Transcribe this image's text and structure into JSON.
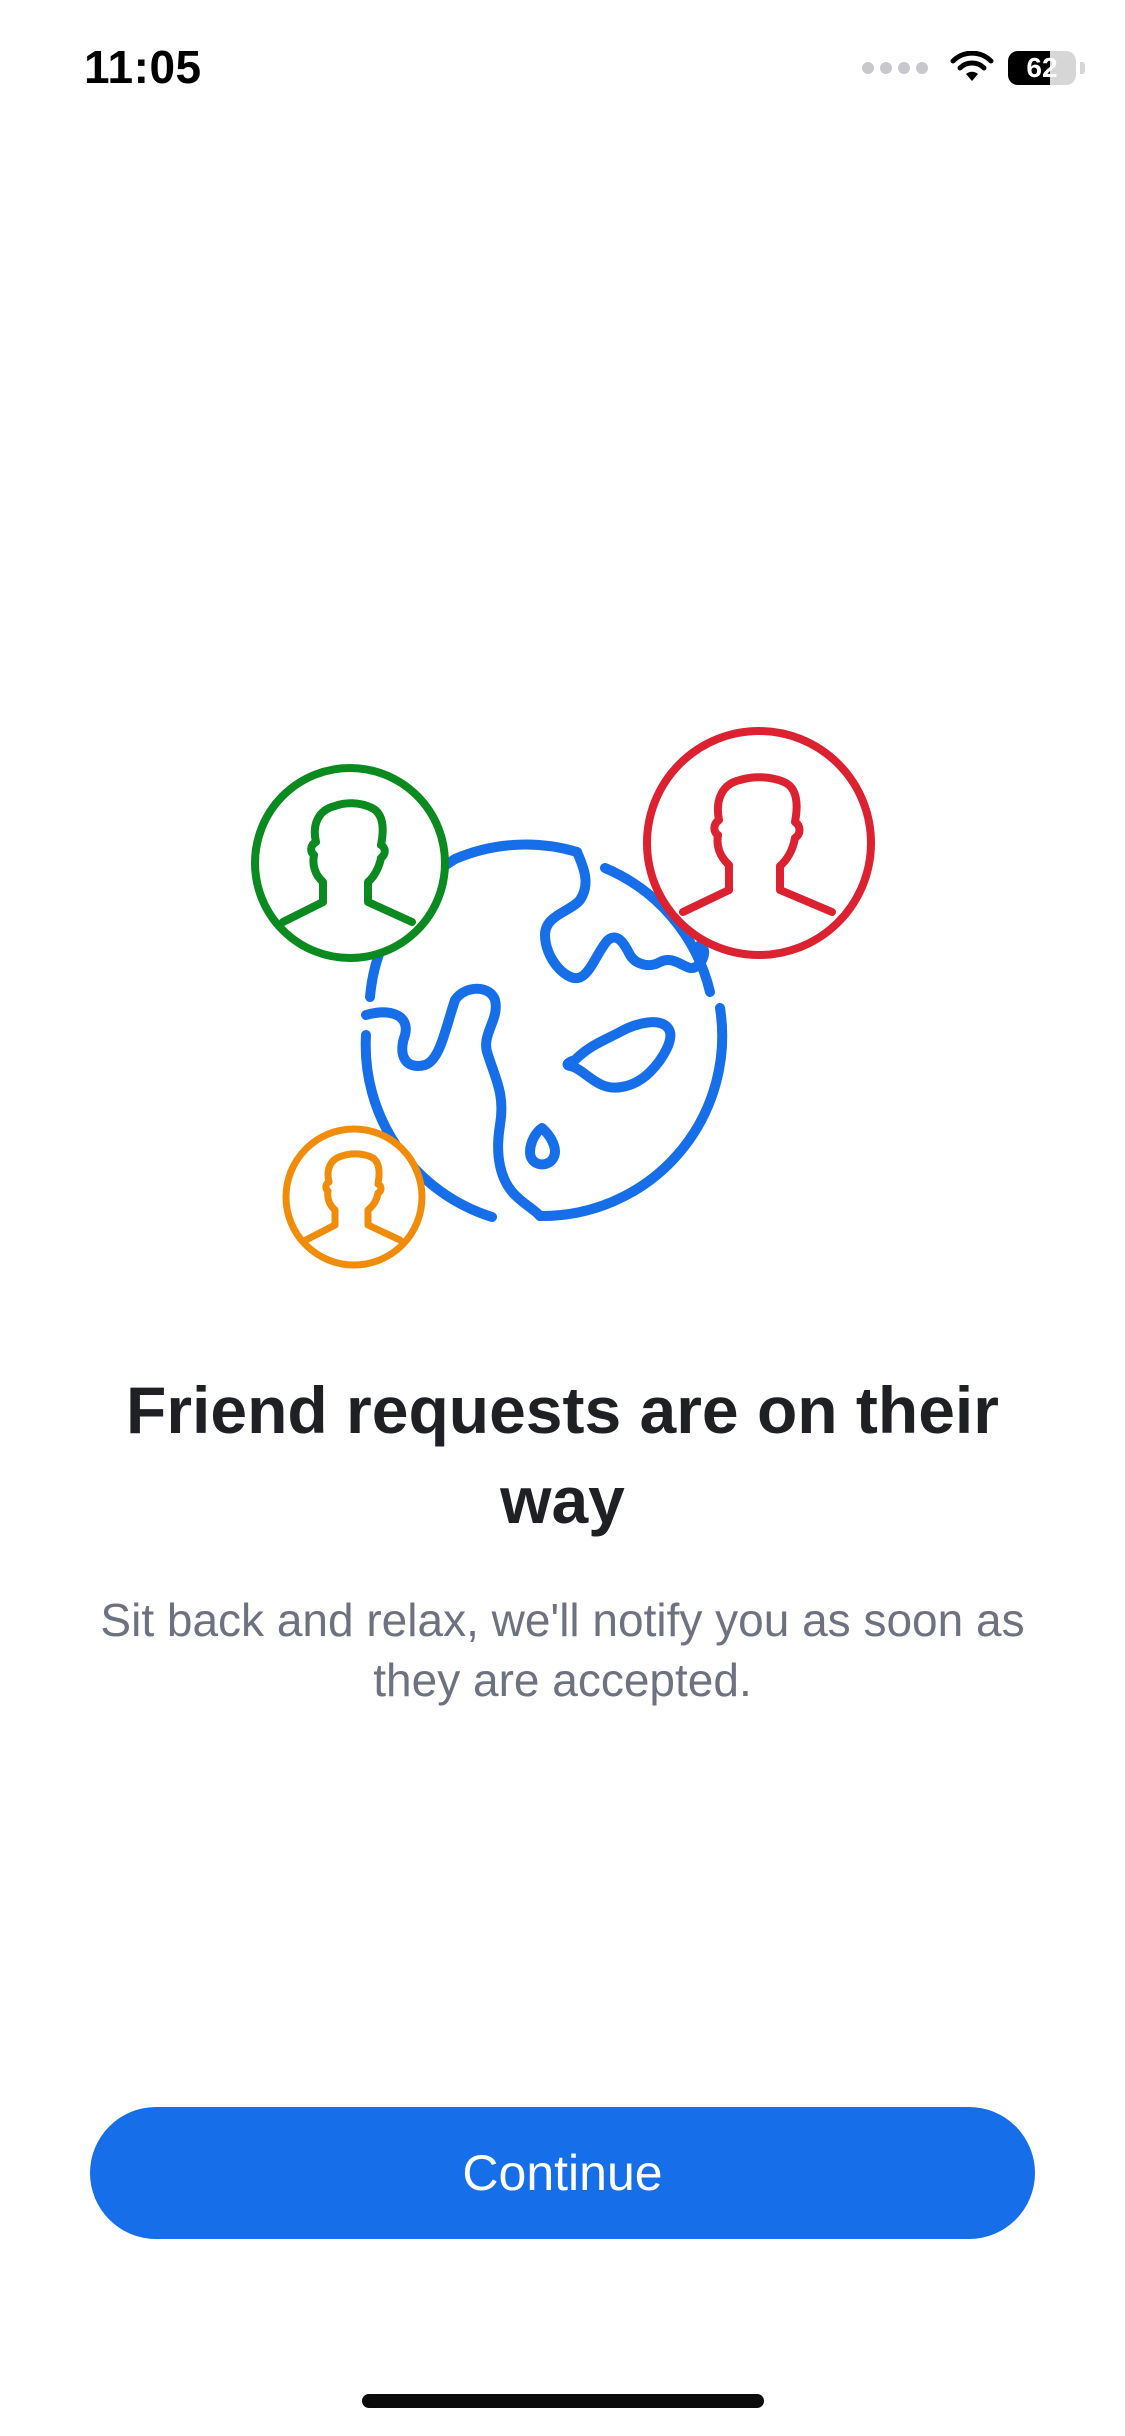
{
  "status_bar": {
    "time": "11:05",
    "battery_level": "62",
    "battery_fraction": 0.62
  },
  "illustration": {
    "icons": [
      "globe-icon",
      "person-icon-green",
      "person-icon-red",
      "person-icon-orange"
    ],
    "colors": {
      "globe": "#166fe9",
      "green": "#0b8a1f",
      "red": "#dc2230",
      "orange": "#f08c0a"
    }
  },
  "content": {
    "title": "Friend requests are on their way",
    "subtitle": "Sit back and relax, we'll notify you as soon as they are accepted."
  },
  "actions": {
    "continue_label": "Continue",
    "accent_color": "#166fe9"
  }
}
